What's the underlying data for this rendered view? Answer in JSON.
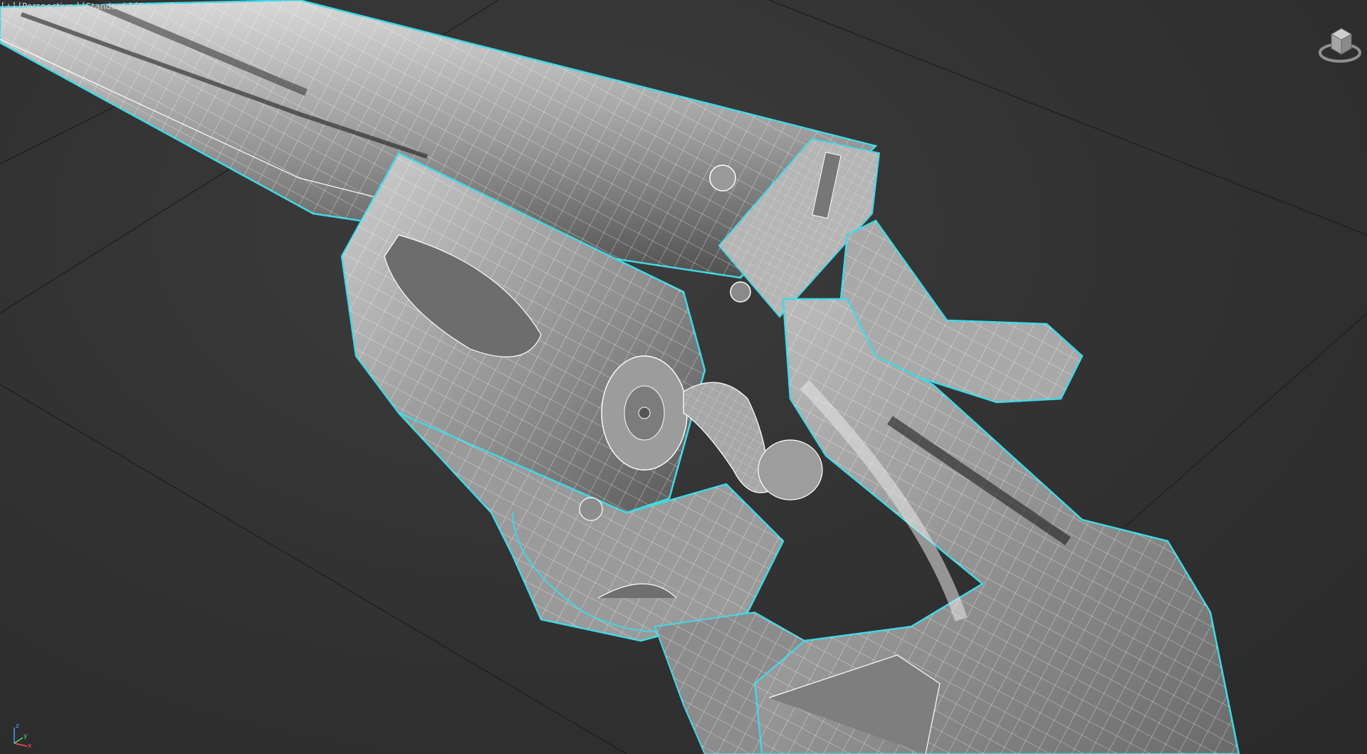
{
  "viewport": {
    "label": {
      "point_of_view": "[+] [Perspective ]",
      "shading": "[Standard ]",
      "display_mode": "[Edged Faces ]"
    },
    "background_color": "#333333",
    "wire_color": "#ffffff",
    "selection_outline_color": "#3fd8e6",
    "model_fill_color": "#a8a8a8",
    "viewcube": {
      "icon": "viewcube-icon"
    },
    "axis_tripod": {
      "icon": "axis-tripod-icon",
      "x_label": "x",
      "y_label": "y",
      "z_label": "z"
    }
  }
}
